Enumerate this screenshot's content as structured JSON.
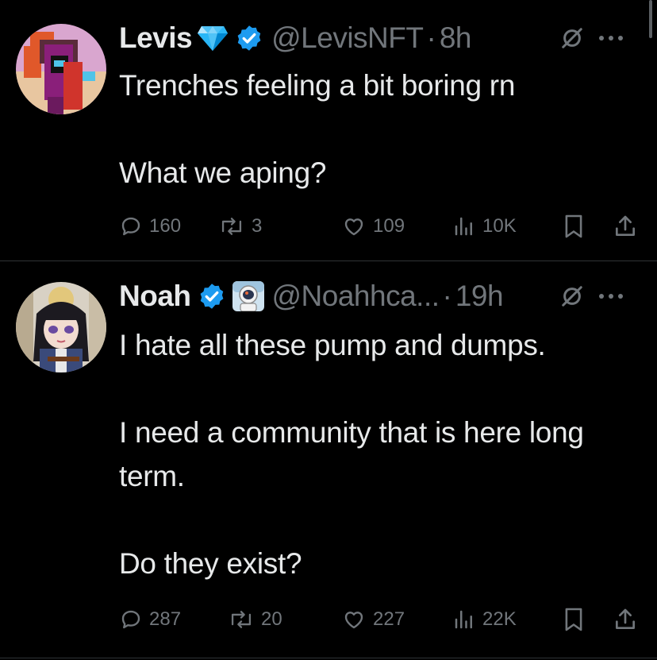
{
  "colors": {
    "background": "#000000",
    "text": "#e7e9ea",
    "muted": "#71767b",
    "verified_blue": "#1d9bf0",
    "divider": "#2f3336"
  },
  "tweets": [
    {
      "name": "Levis",
      "handle": "@LevisNFT",
      "separator": "·",
      "time": "8h",
      "badges": [
        "diamond-emoji",
        "verified-badge"
      ],
      "paragraphs": [
        "Trenches feeling a bit boring rn",
        "What we aping?"
      ],
      "stats": {
        "replies": "160",
        "reposts": "3",
        "likes": "109",
        "views": "10K"
      }
    },
    {
      "name": "Noah",
      "handle": "@Noahhca...",
      "separator": "·",
      "time": "19h",
      "badges": [
        "verified-badge",
        "astronaut-emoji"
      ],
      "paragraphs": [
        "I hate all these pump and dumps.",
        "I need a community that is here long term.",
        "Do they exist?"
      ],
      "stats": {
        "replies": "287",
        "reposts": "20",
        "likes": "227",
        "views": "22K"
      }
    }
  ]
}
